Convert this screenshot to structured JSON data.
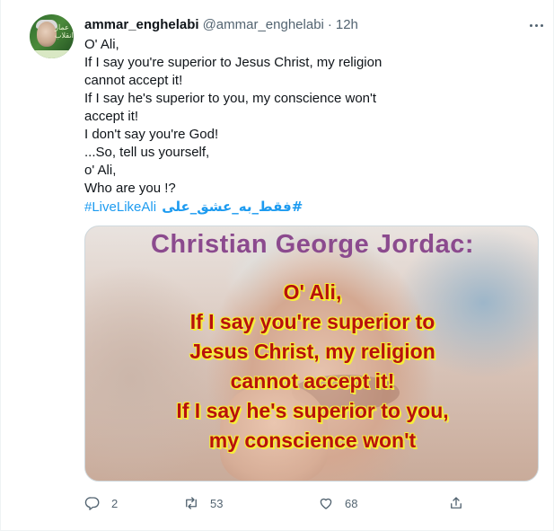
{
  "tweet": {
    "display_name": "ammar_enghelabi",
    "handle": "@ammar_enghelabi",
    "separator": "·",
    "time": "12h",
    "lines": [
      "O' Ali,",
      "If I say you're superior to Jesus Christ, my religion",
      "cannot accept it!",
      "If I say he's superior to you, my conscience won't",
      "accept it!",
      "I don't say you're God!",
      "...So, tell us yourself,",
      "o' Ali,",
      "Who are you !?"
    ],
    "hashtag_1": "#LiveLikeAli",
    "hashtag_2": "#فقط_به_عشق_علی"
  },
  "avatar": {
    "caption": "عمار انقلاب"
  },
  "media": {
    "title": "Christian George Jordac:",
    "quote_lines": [
      "O' Ali,",
      "If I say you're superior to",
      "Jesus Christ, my religion",
      "cannot accept it!",
      "If I say he's superior to you,",
      "my conscience won't"
    ]
  },
  "actions": {
    "reply_count": "2",
    "retweet_count": "53",
    "like_count": "68"
  },
  "icons": {
    "reply": "reply-icon",
    "retweet": "retweet-icon",
    "like": "like-icon",
    "share": "share-icon",
    "more": "more-icon"
  },
  "colors": {
    "link": "#1d9bf0",
    "secondary_text": "#536471",
    "quote_text": "#b8110d",
    "quote_outline": "#f6ee3c",
    "image_title": "#8b4a8e"
  }
}
